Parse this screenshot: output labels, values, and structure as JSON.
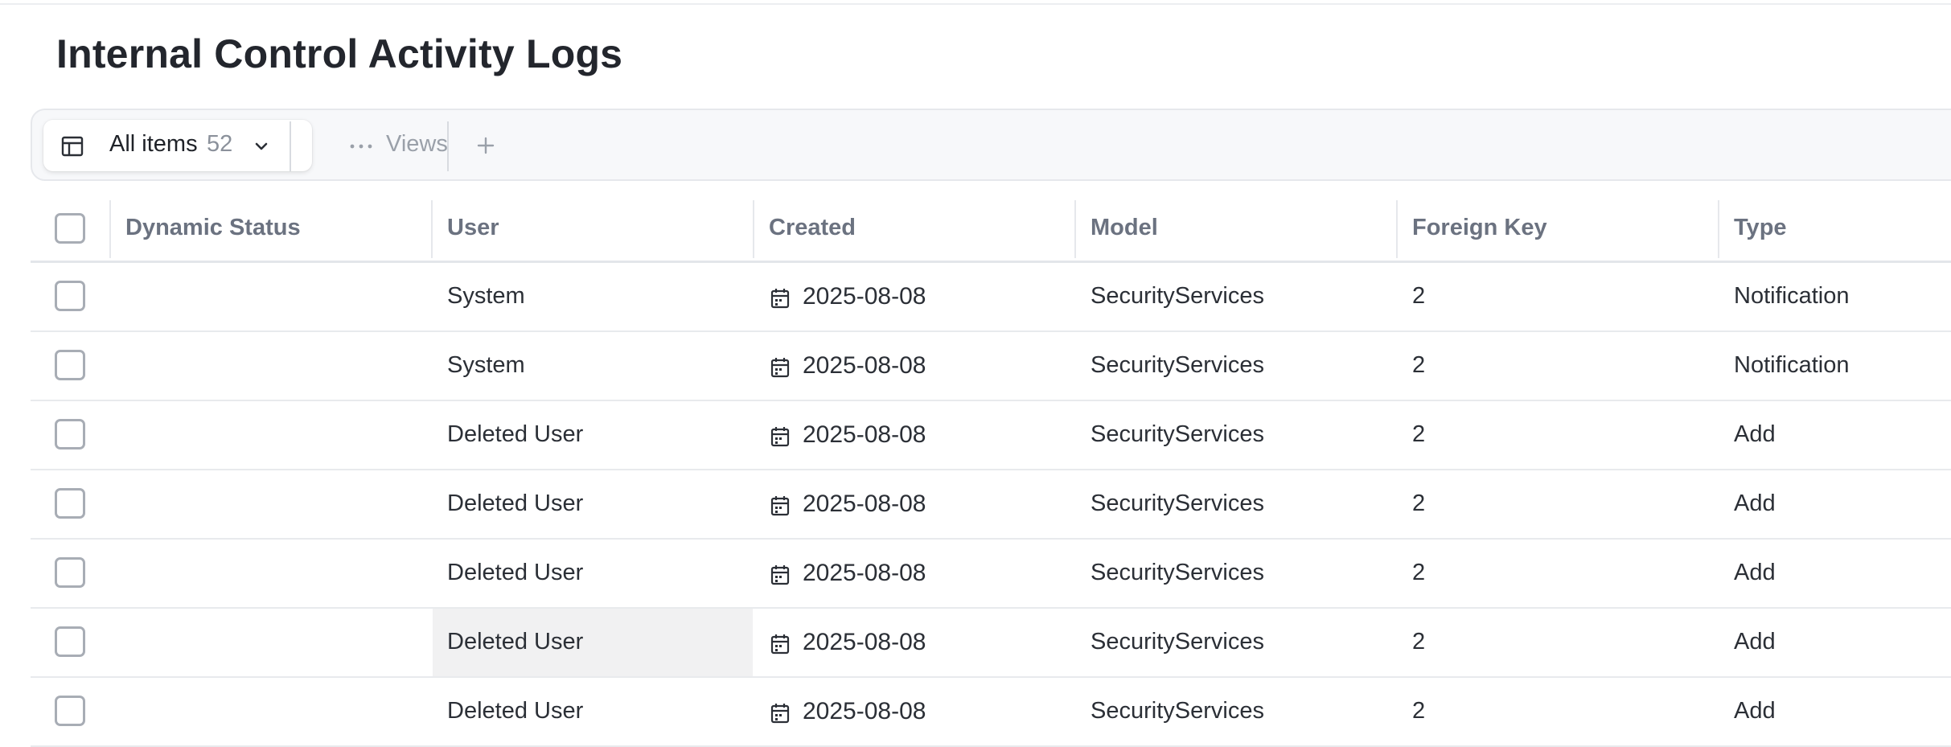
{
  "page": {
    "title": "Internal Control Activity Logs"
  },
  "toolbar": {
    "view_label": "All items",
    "view_count": "52",
    "views_label": "Views"
  },
  "table": {
    "columns": [
      "Dynamic Status",
      "User",
      "Created",
      "Model",
      "Foreign Key",
      "Type"
    ],
    "rows": [
      {
        "dynamic_status": "",
        "user": "System",
        "created": "2025-08-08",
        "model": "SecurityServices",
        "foreign_key": "2",
        "type": "Notification"
      },
      {
        "dynamic_status": "",
        "user": "System",
        "created": "2025-08-08",
        "model": "SecurityServices",
        "foreign_key": "2",
        "type": "Notification"
      },
      {
        "dynamic_status": "",
        "user": "Deleted User",
        "created": "2025-08-08",
        "model": "SecurityServices",
        "foreign_key": "2",
        "type": "Add"
      },
      {
        "dynamic_status": "",
        "user": "Deleted User",
        "created": "2025-08-08",
        "model": "SecurityServices",
        "foreign_key": "2",
        "type": "Add"
      },
      {
        "dynamic_status": "",
        "user": "Deleted User",
        "created": "2025-08-08",
        "model": "SecurityServices",
        "foreign_key": "2",
        "type": "Add"
      },
      {
        "dynamic_status": "",
        "user": "Deleted User",
        "created": "2025-08-08",
        "model": "SecurityServices",
        "foreign_key": "2",
        "type": "Add"
      },
      {
        "dynamic_status": "",
        "user": "Deleted User",
        "created": "2025-08-08",
        "model": "SecurityServices",
        "foreign_key": "2",
        "type": "Add"
      }
    ]
  }
}
